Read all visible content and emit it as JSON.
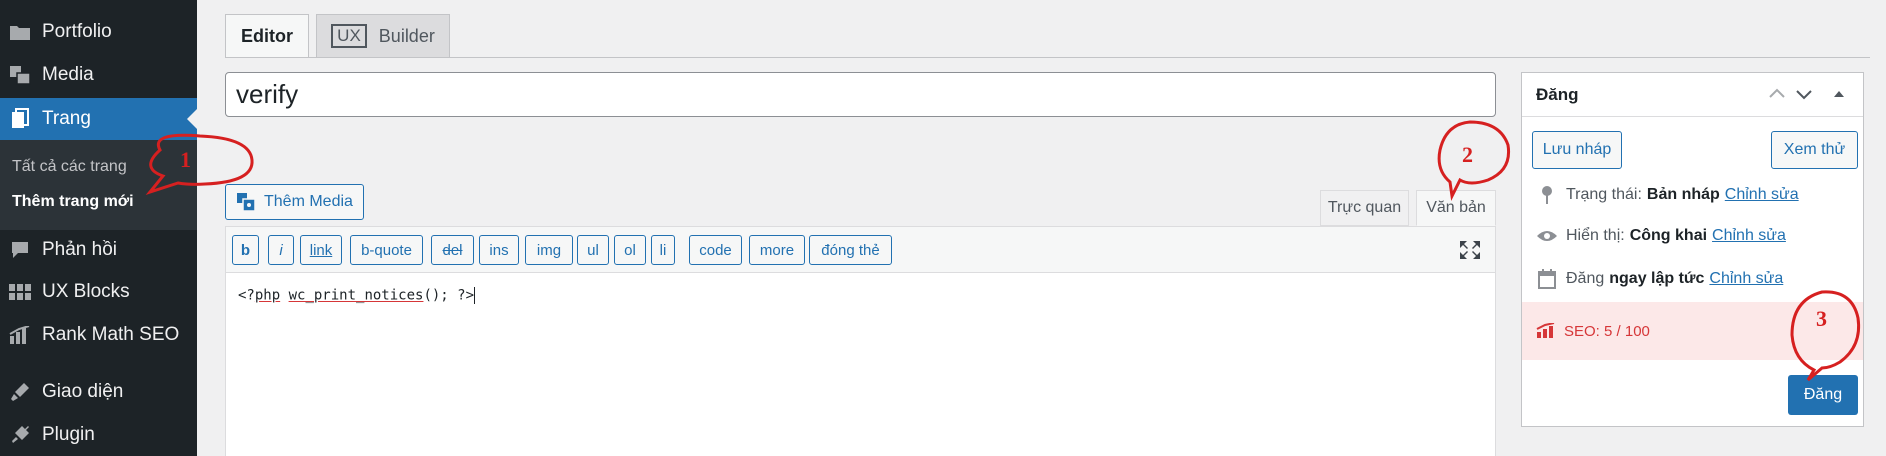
{
  "sidebar": {
    "items": [
      {
        "label": "Portfolio",
        "icon": "folder-icon"
      },
      {
        "label": "Media",
        "icon": "media-icon"
      },
      {
        "label": "Trang",
        "icon": "pages-icon",
        "active": true
      },
      {
        "label": "Phản hồi",
        "icon": "comment-icon"
      },
      {
        "label": "UX Blocks",
        "icon": "grid-icon"
      },
      {
        "label": "Rank Math SEO",
        "icon": "chart-icon"
      },
      {
        "label": "Giao diện",
        "icon": "brush-icon"
      },
      {
        "label": "Plugin",
        "icon": "plugin-icon"
      }
    ],
    "submenu": [
      {
        "label": "Tất cả các trang"
      },
      {
        "label": "Thêm trang mới",
        "current": true
      }
    ]
  },
  "builder_tabs": {
    "editor": "Editor",
    "ux_badge": "UX",
    "ux_label": "Builder"
  },
  "title_value": "verify",
  "add_media_label": "Thêm Media",
  "mode_tabs": {
    "visual": "Trực quan",
    "text": "Văn bản"
  },
  "quicktags": [
    "b",
    "i",
    "link",
    "b-quote",
    "del",
    "ins",
    "img",
    "ul",
    "ol",
    "li",
    "code",
    "more",
    "đóng thẻ"
  ],
  "editor_content": {
    "prefix": "<?",
    "php": "php",
    "func": "wc_print_notices",
    "suffix": "(); ?>"
  },
  "publish": {
    "title": "Đăng",
    "save_draft": "Lưu nháp",
    "preview": "Xem thử",
    "status_label": "Trạng thái:",
    "status_value": "Bản nháp",
    "visibility_label": "Hiển thị:",
    "visibility_value": "Công khai",
    "schedule_label": "Đăng",
    "schedule_value": "ngay lập tức",
    "edit_link": "Chỉnh sửa",
    "seo": "SEO: 5 / 100",
    "publish_button": "Đăng"
  },
  "annotations": [
    "1",
    "2",
    "3"
  ],
  "colors": {
    "sidebar_bg": "#1d2327",
    "accent": "#2271b1",
    "annotation": "#d62020",
    "seo_bg": "#fce8e8"
  }
}
